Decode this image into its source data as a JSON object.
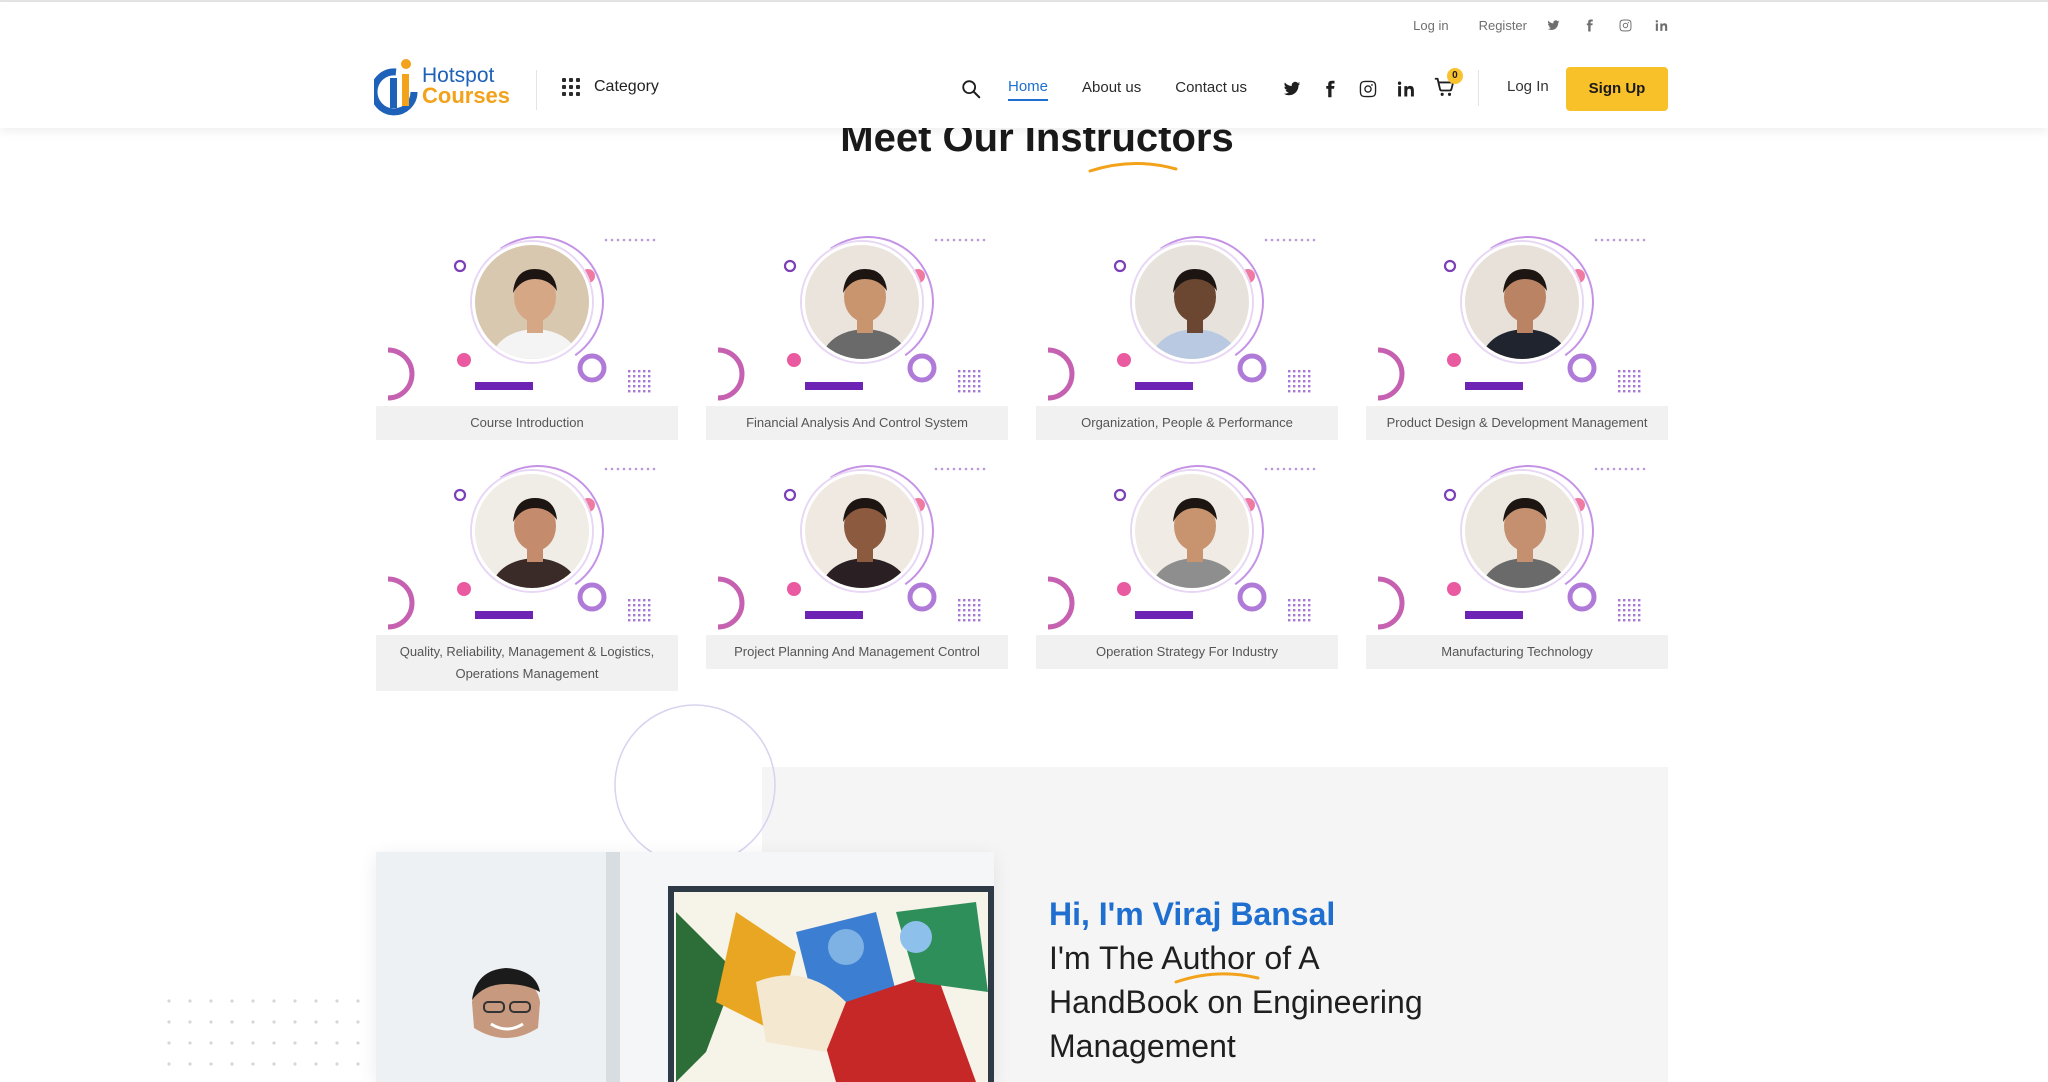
{
  "topbar": {
    "login": "Log in",
    "register": "Register",
    "icons": [
      "twitter-icon",
      "facebook-icon",
      "instagram-icon",
      "linkedin-icon"
    ]
  },
  "header": {
    "logo_line1": "Hotspot",
    "logo_line2": "Courses",
    "category_label": "Category",
    "nav": [
      {
        "label": "Home",
        "active": true
      },
      {
        "label": "About us",
        "active": false
      },
      {
        "label": "Contact us",
        "active": false
      }
    ],
    "cart_count": "0",
    "login_label": "Log In",
    "signup_label": "Sign Up"
  },
  "instructors": {
    "title": "Meet Our Instructors",
    "cards": [
      {
        "caption": "Course Introduction"
      },
      {
        "caption": "Financial Analysis And Control System"
      },
      {
        "caption": "Organization, People & Performance"
      },
      {
        "caption": "Product Design & Development Management"
      },
      {
        "caption": "Quality, Reliability, Management & Logistics, Operations Management"
      },
      {
        "caption": "Project Planning And Management Control"
      },
      {
        "caption": "Operation Strategy For Industry"
      },
      {
        "caption": "Manufacturing Technology"
      }
    ]
  },
  "about": {
    "greeting": "Hi, I'm Viraj Bansal",
    "line1": "I'm The Author of A",
    "line2": "HandBook on Engineering",
    "line3": "Management"
  },
  "colors": {
    "brand_blue": "#1f6fd0",
    "accent_yellow": "#f8c12a",
    "purple": "#7b2fbf",
    "pink": "#ef5fa7"
  }
}
